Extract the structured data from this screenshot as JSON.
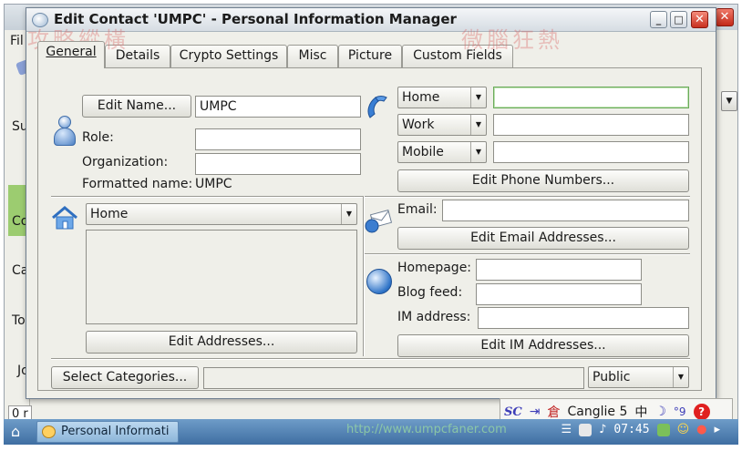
{
  "background_app": {
    "menu_first": "Fil",
    "side_labels": [
      "Su",
      "Co",
      "Ca",
      "To",
      "Jo"
    ],
    "status_prefix": "0 r"
  },
  "watermarks": {
    "left": "攻略縱橫",
    "right": "微腦狂熱",
    "url": "http://www.umpcfaner.com"
  },
  "dialog": {
    "title": "Edit Contact 'UMPC' - Personal Information Manager",
    "tabs": [
      {
        "label": "General",
        "active": true
      },
      {
        "label": "Details",
        "active": false
      },
      {
        "label": "Crypto Settings",
        "active": false
      },
      {
        "label": "Misc",
        "active": false
      },
      {
        "label": "Picture",
        "active": false
      },
      {
        "label": "Custom Fields",
        "active": false
      }
    ],
    "name": {
      "edit_name_button": "Edit Name...",
      "name_value": "UMPC",
      "role_label": "Role:",
      "role_value": "",
      "organization_label": "Organization:",
      "organization_value": "",
      "formatted_name_label": "Formatted name:",
      "formatted_name_value": "UMPC"
    },
    "phones": {
      "rows": [
        {
          "type": "Home",
          "value": ""
        },
        {
          "type": "Work",
          "value": ""
        },
        {
          "type": "Mobile",
          "value": ""
        }
      ],
      "edit_button": "Edit Phone Numbers..."
    },
    "address": {
      "type": "Home",
      "text": "",
      "edit_button": "Edit Addresses..."
    },
    "email": {
      "label": "Email:",
      "value": "",
      "edit_button": "Edit Email Addresses..."
    },
    "web": {
      "homepage_label": "Homepage:",
      "homepage_value": "",
      "blog_label": "Blog feed:",
      "blog_value": "",
      "im_label": "IM address:",
      "im_value": "",
      "edit_im_button": "Edit IM Addresses..."
    },
    "categories": {
      "button": "Select Categories...",
      "value": "",
      "access": "Public"
    }
  },
  "taskbar": {
    "task_label": "Personal Informati",
    "clock": "07:45"
  },
  "ime_bar": {
    "logo": "SC",
    "name": "Canglie 5",
    "mode": "中"
  },
  "colors": {
    "window_bg": "#efefe9",
    "taskbar": "#3f6ea2",
    "focus_border": "#6aaa5a"
  }
}
